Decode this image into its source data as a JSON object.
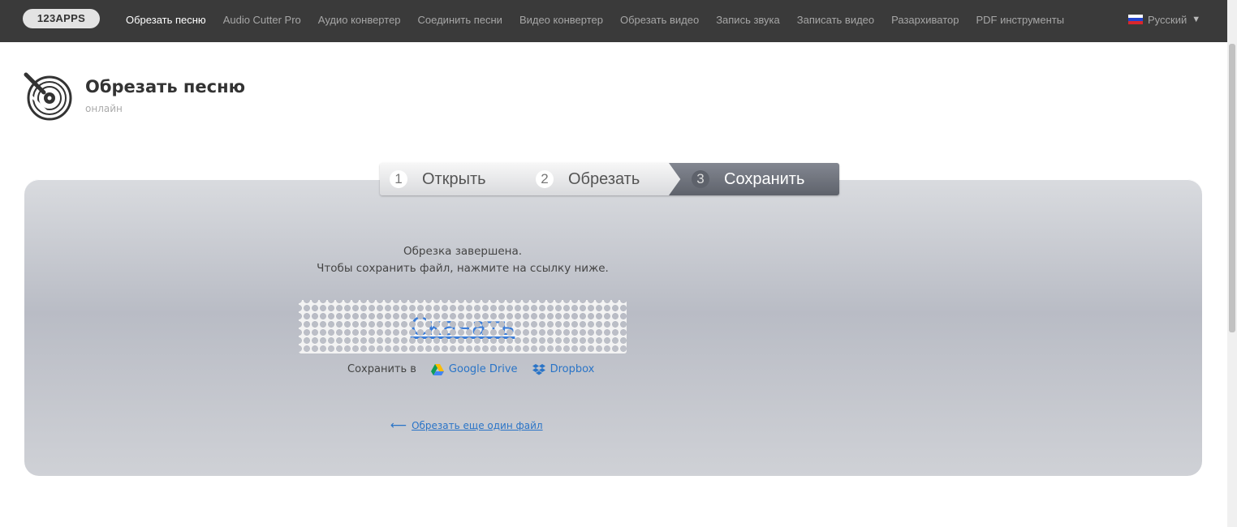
{
  "nav": {
    "logo": "123APPS",
    "items": [
      {
        "label": "Обрезать песню",
        "active": true
      },
      {
        "label": "Audio Cutter Pro"
      },
      {
        "label": "Аудио конвертер"
      },
      {
        "label": "Соединить песни"
      },
      {
        "label": "Видео конвертер"
      },
      {
        "label": "Обрезать видео"
      },
      {
        "label": "Запись звука"
      },
      {
        "label": "Записать видео"
      },
      {
        "label": "Разархиватор"
      },
      {
        "label": "PDF инструменты"
      }
    ],
    "language": "Русский"
  },
  "header": {
    "title": "Обрезать песню",
    "subtitle": "онлайн"
  },
  "steps": [
    {
      "num": "1",
      "label": "Открыть"
    },
    {
      "num": "2",
      "label": "Обрезать"
    },
    {
      "num": "3",
      "label": "Сохранить",
      "active": true
    }
  ],
  "result": {
    "line1": "Обрезка завершена.",
    "line2": "Чтобы сохранить файл, нажмите на ссылку ниже.",
    "download_label": "Скачать",
    "save_to_label": "Сохранить в",
    "google_drive_label": "Google Drive",
    "dropbox_label": "Dropbox",
    "again_label": "Обрезать еще один файл"
  },
  "colors": {
    "nav_bg": "#3a3a3a",
    "link": "#2a74c7",
    "active_step": "#5e626b"
  }
}
